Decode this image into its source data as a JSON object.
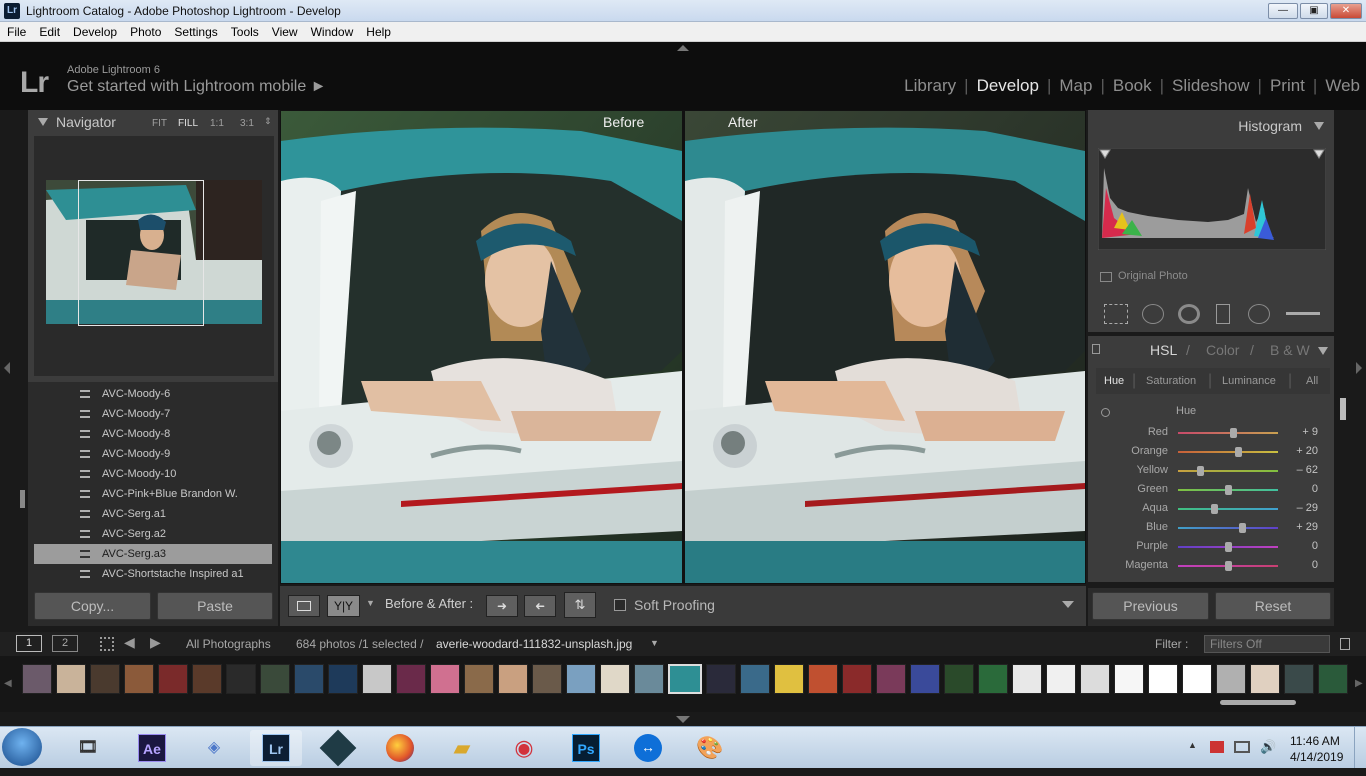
{
  "window": {
    "badge": "Lr",
    "title": "Lightroom Catalog - Adobe Photoshop Lightroom - Develop",
    "min": "—",
    "max": "▣",
    "close": "✕"
  },
  "menu": [
    "File",
    "Edit",
    "Develop",
    "Photo",
    "Settings",
    "Tools",
    "View",
    "Window",
    "Help"
  ],
  "identity": {
    "logo": "Lr",
    "version": "Adobe Lightroom 6",
    "mobile": "Get started with Lightroom mobile ►"
  },
  "modules": [
    "Library",
    "Develop",
    "Map",
    "Book",
    "Slideshow",
    "Print",
    "Web"
  ],
  "active_module": "Develop",
  "navigator": {
    "title": "Navigator",
    "zoom": [
      "FIT",
      "FILL",
      "1:1",
      "3:1"
    ],
    "active_zoom": "FILL"
  },
  "presets": [
    "AVC-Moody-6",
    "AVC-Moody-7",
    "AVC-Moody-8",
    "AVC-Moody-9",
    "AVC-Moody-10",
    "AVC-Pink+Blue Brandon W.",
    "AVC-Serg.a1",
    "AVC-Serg.a2",
    "AVC-Serg.a3",
    "AVC-Shortstache Inspired a1"
  ],
  "selected_preset": "AVC-Serg.a3",
  "left_buttons": {
    "copy": "Copy...",
    "paste": "Paste"
  },
  "compare": {
    "before": "Before",
    "after": "After"
  },
  "toolbar": {
    "yy": "Y|Y",
    "before_after": "Before & After :",
    "soft_proofing": "Soft Proofing"
  },
  "histogram": {
    "title": "Histogram",
    "original_photo": "Original Photo"
  },
  "hsl": {
    "header": [
      "HSL",
      "/",
      "Color",
      "/",
      "B & W"
    ],
    "tabs": [
      "Hue",
      "Saturation",
      "Luminance",
      "All"
    ],
    "active_tab": "Hue",
    "section": "Hue",
    "rows": [
      {
        "label": "Red",
        "value": "+ 9",
        "level": 0.55
      },
      {
        "label": "Orange",
        "value": "+ 20",
        "level": 0.6
      },
      {
        "label": "Yellow",
        "value": "– 62",
        "level": 0.22
      },
      {
        "label": "Green",
        "value": "0",
        "level": 0.5
      },
      {
        "label": "Aqua",
        "value": "– 29",
        "level": 0.36
      },
      {
        "label": "Blue",
        "value": "+ 29",
        "level": 0.64
      },
      {
        "label": "Purple",
        "value": "0",
        "level": 0.5
      },
      {
        "label": "Magenta",
        "value": "0",
        "level": 0.5
      }
    ]
  },
  "right_buttons": {
    "previous": "Previous",
    "reset": "Reset"
  },
  "filmstrip_bar": {
    "page1": "1",
    "page2": "2",
    "source": "All Photographs",
    "count": "684 photos /1 selected /",
    "filename": "averie-woodard-111832-unsplash.jpg",
    "filter_label": "Filter :",
    "filter_value": "Filters Off"
  },
  "taskbar": {
    "time": "11:46 AM",
    "date": "4/14/2019",
    "apps": [
      "Ae",
      "Lr",
      "Ps"
    ]
  },
  "colors": {
    "lr_bg": "#1a1a1a",
    "panel": "#3c3c3c",
    "teal_truck": "#2e8f94",
    "taskbar": "#bcd1e6"
  }
}
